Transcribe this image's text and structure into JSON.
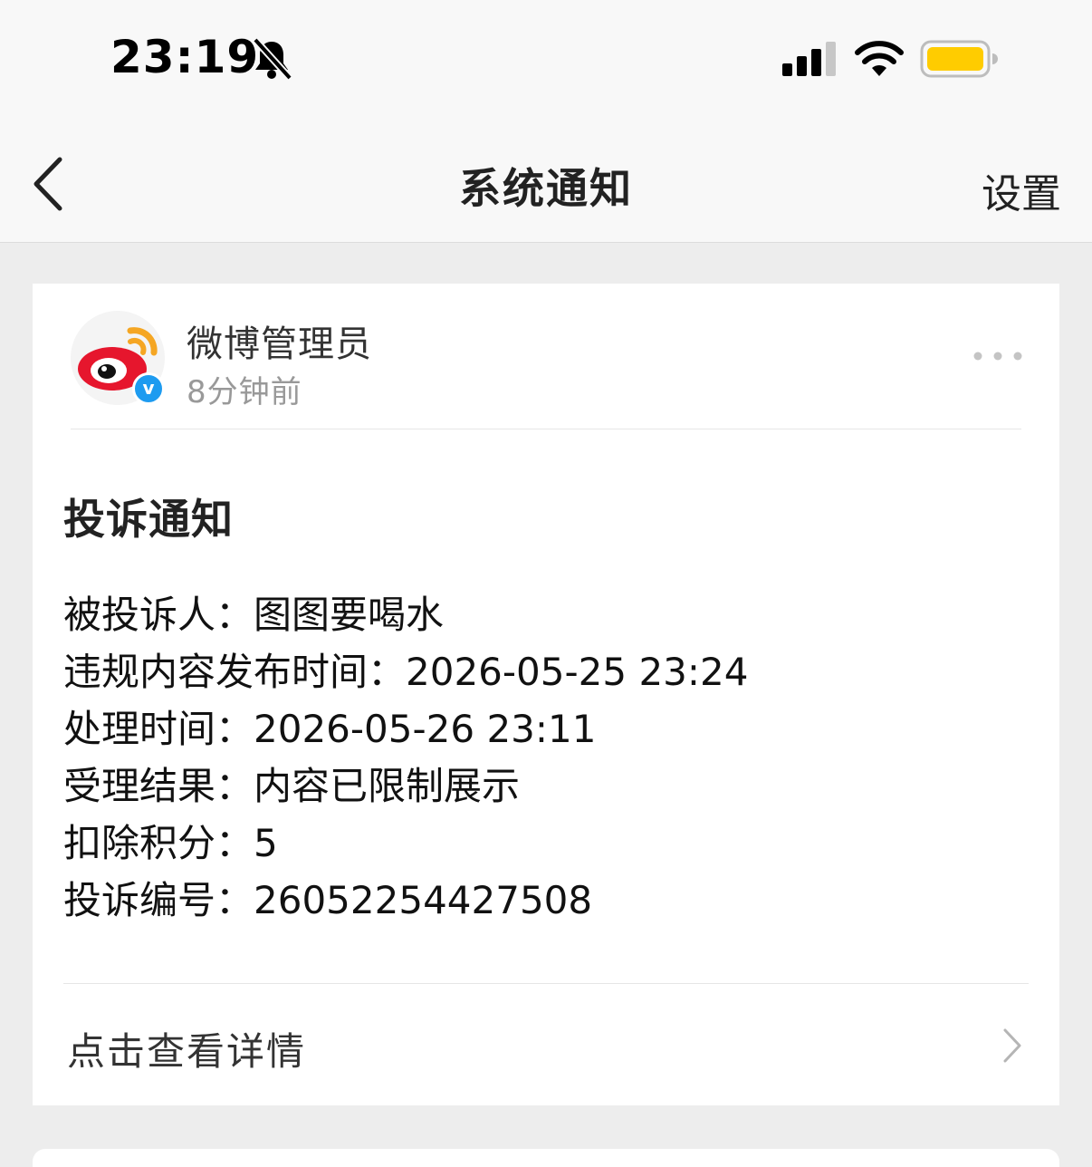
{
  "status_bar": {
    "time": "23:19",
    "silent_icon": "bell-slash-icon",
    "signal_icon": "cellular-signal-icon",
    "wifi_icon": "wifi-icon",
    "battery_icon": "battery-icon",
    "battery_color": "#ffcc00"
  },
  "nav": {
    "back_icon": "chevron-left-icon",
    "title": "系统通知",
    "settings_label": "设置"
  },
  "message": {
    "sender_name": "微博管理员",
    "time_ago": "8分钟前",
    "avatar_icon": "weibo-logo-icon",
    "verified_badge": "v",
    "verified_color": "#1d9bf0",
    "more_icon": "more-dots-icon",
    "title": "投诉通知",
    "details": [
      {
        "label": "被投诉人：",
        "value": "图图要喝水"
      },
      {
        "label": "违规内容发布时间：",
        "value": "2026-05-25 23:24"
      },
      {
        "label": "处理时间：",
        "value": "2026-05-26 23:11"
      },
      {
        "label": "受理结果：",
        "value": "内容已限制展示"
      },
      {
        "label": "扣除积分：",
        "value": "5"
      },
      {
        "label": "投诉编号：",
        "value": "26052254427508"
      }
    ],
    "view_details_label": "点击查看详情",
    "view_details_icon": "chevron-right-icon"
  }
}
